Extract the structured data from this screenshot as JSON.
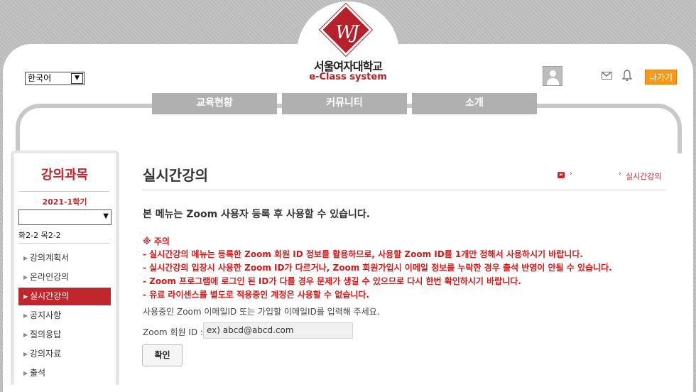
{
  "header": {
    "university_name": "서울여자대학교",
    "system_name": "e-Class system",
    "logo_mark": "WJ",
    "language": "한국어",
    "logout_label": "나가기"
  },
  "nav": {
    "tabs": [
      {
        "label": "교육현황"
      },
      {
        "label": "커뮤니티"
      },
      {
        "label": "소개"
      }
    ]
  },
  "sidebar": {
    "title": "강의과목",
    "term": "2021-1학기",
    "course_value": "",
    "schedule": "화2-2 목2-2",
    "items": [
      {
        "label": "강의계획서",
        "active": false
      },
      {
        "label": "온라인강의",
        "active": false
      },
      {
        "label": "실시간강의",
        "active": true
      },
      {
        "label": "공지사항",
        "active": false
      },
      {
        "label": "질의응답",
        "active": false
      },
      {
        "label": "강의자료",
        "active": false
      },
      {
        "label": "출석",
        "active": false
      }
    ]
  },
  "main": {
    "title": "실시간강의",
    "breadcrumb_home": "H",
    "breadcrumb_current": "실시간강의",
    "intro": "본 메뉴는 Zoom 사용자 등록 후 사용할 수 있습니다.",
    "warning_title": "※ 주의",
    "warnings": [
      "- 실시간강의 메뉴는 등록한 Zoom 회원 ID 정보를 활용하므로, 사용할 Zoom ID를 1개만 정해서 사용하시기 바랍니다.",
      "- 실시간강의 입장시 사용한 Zoom ID가 다르거나, Zoom 회원가입시 이메일 정보를 누락한 경우 출석 반영이 안될 수 있습니다.",
      "- Zoom 프로그램에 로그인 된 ID가 다를 경우 문제가 생길 수 있으므로 다시 한번 확인하시기 바랍니다.",
      "- 유료 라이센스를 별도로 적용중인 계정은 사용할 수 없습니다."
    ],
    "help_text": "사용중인 Zoom 이메일ID 또는 가입할 이메일ID를 입력해 주세요.",
    "id_label": "Zoom 회원 ID :",
    "id_placeholder": "ex) abcd@abcd.com",
    "confirm_label": "확인"
  },
  "colors": {
    "accent": "#c0272d",
    "warning": "#d11a1a",
    "logout": "#f39a1d",
    "nav_tab": "#b0b0b0"
  }
}
